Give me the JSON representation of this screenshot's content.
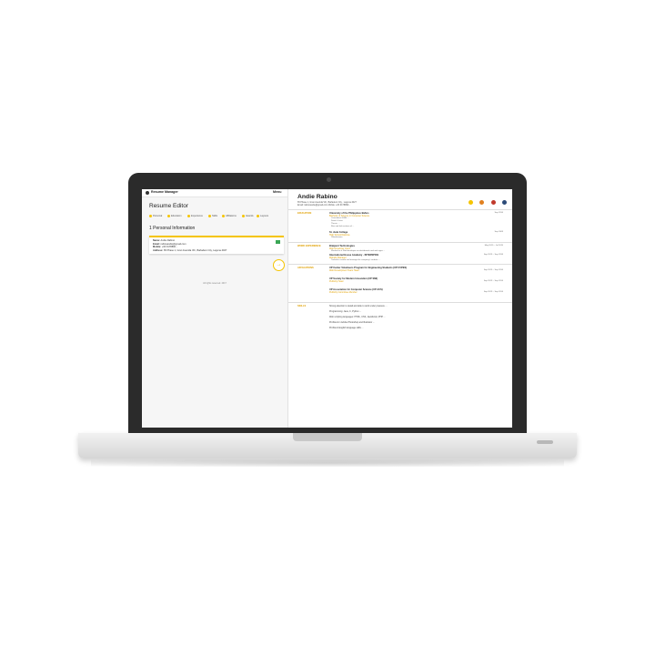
{
  "app": {
    "name": "Resume Manager",
    "menu": "Menu"
  },
  "editor": {
    "title": "Resume Editor",
    "steps": [
      "Personal",
      "Education",
      "Experience",
      "Skills",
      "Affiliations",
      "Awards",
      "Layouts"
    ],
    "section_title": "1 Personal Information",
    "info": {
      "name_label": "Name:",
      "name_value": "Andie Rabino",
      "email_label": "Email:",
      "email_value": "rabinoandie@gmail.com",
      "mobile_label": "Mobile:",
      "mobile_value": "+63 9178890...",
      "address_label": "Address:",
      "address_value": "65 Phase 1, Gran Avenida Vill., Bañadero City, Laguna 4027"
    },
    "next_icon": "→",
    "footer_note": "All rights reserved. 2017"
  },
  "colors": {
    "accent": "#f5c400",
    "accent_text": "#e0a000",
    "theme_dots": [
      "#f5c400",
      "#e08020",
      "#c0392b",
      "#2c4a78"
    ]
  },
  "resume": {
    "name": "Andie Rabino",
    "contact_line": "65 Phase 1, Gran Avenida Vill., Bañadero City , Laguna 4027",
    "contact_line2": "Email: rabinoandie@gmail.com   Mobile: +63 9178890...",
    "sections": [
      {
        "label": "EDUCATION"
      },
      {
        "label": "WORK EXPERIENCE"
      },
      {
        "label": "AFFILIATIONS"
      },
      {
        "label": "SKILLS"
      }
    ],
    "education": [
      {
        "title": "University of the Philippines Baños",
        "sub": "Bachelor of Science in Computer Science",
        "date": "Sep 2016",
        "lines": [
          "Cumulative GWA: ...",
          "Dean's Lister",
          "Thesis: ...",
          "Ran and led sections of ..."
        ]
      },
      {
        "title": "St. Jude College",
        "sub": "High School Diploma",
        "date": "Sep 2009",
        "lines": [
          "Valedictorian"
        ]
      }
    ],
    "work": [
      {
        "title": "Braipunt Technologies",
        "sub": "Web Developer Intern",
        "date": "May 2015 – Jul 2015",
        "lines": [
          "Worked as a Web developer on dashboards and web apps ..."
        ]
      },
      {
        "title": "International House Academy - INTERSPICE",
        "sub": "Website Manager",
        "date": "Sep 2015 – Sep 2016",
        "lines": [
          "Tasked to create and manage the company's website ..."
        ]
      }
    ],
    "affiliations": [
      {
        "title": "UP Center Volunteers Program for Engineering Students (UP CVPES)",
        "sub": "Web Development Team Head",
        "date": "Sep 2015 – Sep 2016"
      },
      {
        "title": "UP Society for Modern Innovation (UP SMI)",
        "sub": "Publicity Head",
        "date": "Sep 2013 – Sep 2014"
      },
      {
        "title": "UP Association for Computer Science (UP ACS)",
        "sub": "Publicity Committee Member",
        "date": "Sep 2013 – Sep 2014"
      }
    ],
    "skills": [
      "Strong attention to detail and able to work under pressure ...",
      "Programming: Java, C, Python ...",
      "Web scripting languages: HTML, CSS, JavaScript, PHP ...",
      "Proficient in Adobe Photoshop and Illustrator ...",
      "Proficient English language skills ..."
    ]
  }
}
